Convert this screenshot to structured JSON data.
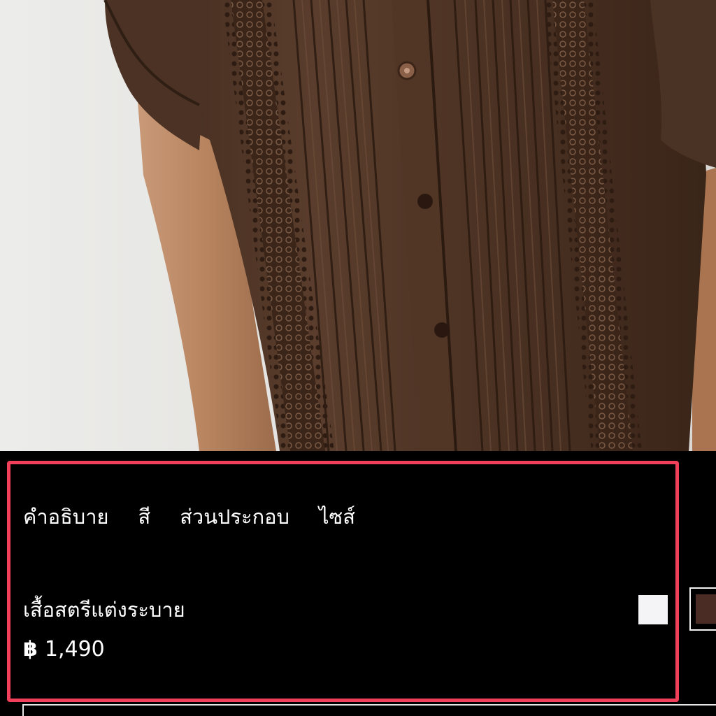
{
  "tabs": [
    {
      "label": "คำอธิบาย"
    },
    {
      "label": "สี"
    },
    {
      "label": "ส่วนประกอบ"
    },
    {
      "label": "ไซส์"
    }
  ],
  "product": {
    "name": "เสื้อสตรีแต่งระบาย",
    "currency": "฿",
    "price": "1,490"
  },
  "colors": {
    "highlight": "#f0405a",
    "swatches": [
      "#f4f4f6",
      "#4a2c24"
    ]
  }
}
